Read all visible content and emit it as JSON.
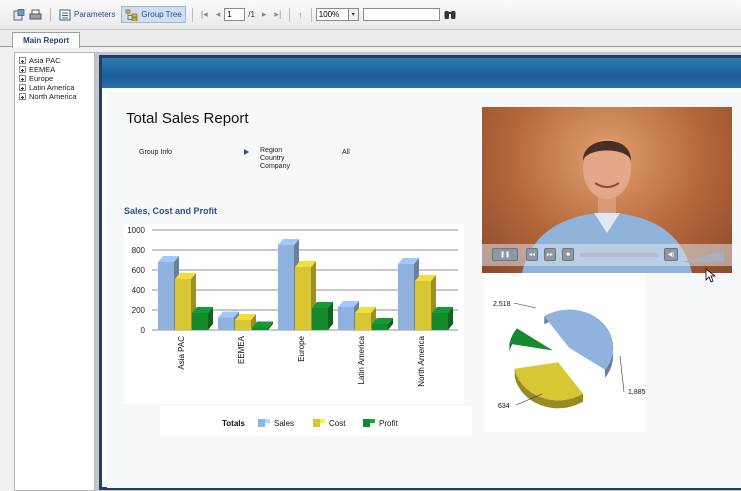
{
  "toolbar": {
    "parameters_label": "Parameters",
    "group_tree_label": "Group Tree",
    "page_value": "1",
    "page_total": "/1",
    "zoom_value": "100%",
    "search_value": ""
  },
  "tabs": {
    "main_report": "Main Report"
  },
  "tree": {
    "items": [
      "Asia PAC",
      "EEMEA",
      "Europe",
      "Latin America",
      "North America"
    ]
  },
  "report": {
    "title": "Total Sales Report",
    "group_info_label": "Group Info",
    "group_levels": [
      "Region",
      "Country",
      "Company"
    ],
    "group_value": "All",
    "subtitle": "Sales, Cost and Profit"
  },
  "chart_data": [
    {
      "type": "bar",
      "categories": [
        "Asia PAC",
        "EEMEA",
        "Europe",
        "Latin America",
        "North America"
      ],
      "series": [
        {
          "name": "Sales",
          "values": [
            680,
            125,
            850,
            230,
            660
          ],
          "color": "#8fb3de"
        },
        {
          "name": "Cost",
          "values": [
            510,
            100,
            630,
            170,
            490
          ],
          "color": "#d8c632"
        },
        {
          "name": "Profit",
          "values": [
            170,
            25,
            220,
            60,
            170
          ],
          "color": "#138a2e"
        }
      ],
      "y_ticks": [
        "1000",
        "800",
        "600",
        "400",
        "200",
        "0"
      ],
      "ylim": [
        0,
        1000
      ],
      "legend_title": "Totals"
    },
    {
      "type": "pie",
      "slices": [
        {
          "label": "2,518",
          "value": 2518,
          "color": "#8fb3de"
        },
        {
          "label": "1,885",
          "value": 1885,
          "color": "#d8c632"
        },
        {
          "label": "634",
          "value": 634,
          "color": "#138a2e"
        }
      ]
    }
  ],
  "colors": {
    "accent": "#1b5e97",
    "title_blue": "#2b4f8e"
  }
}
